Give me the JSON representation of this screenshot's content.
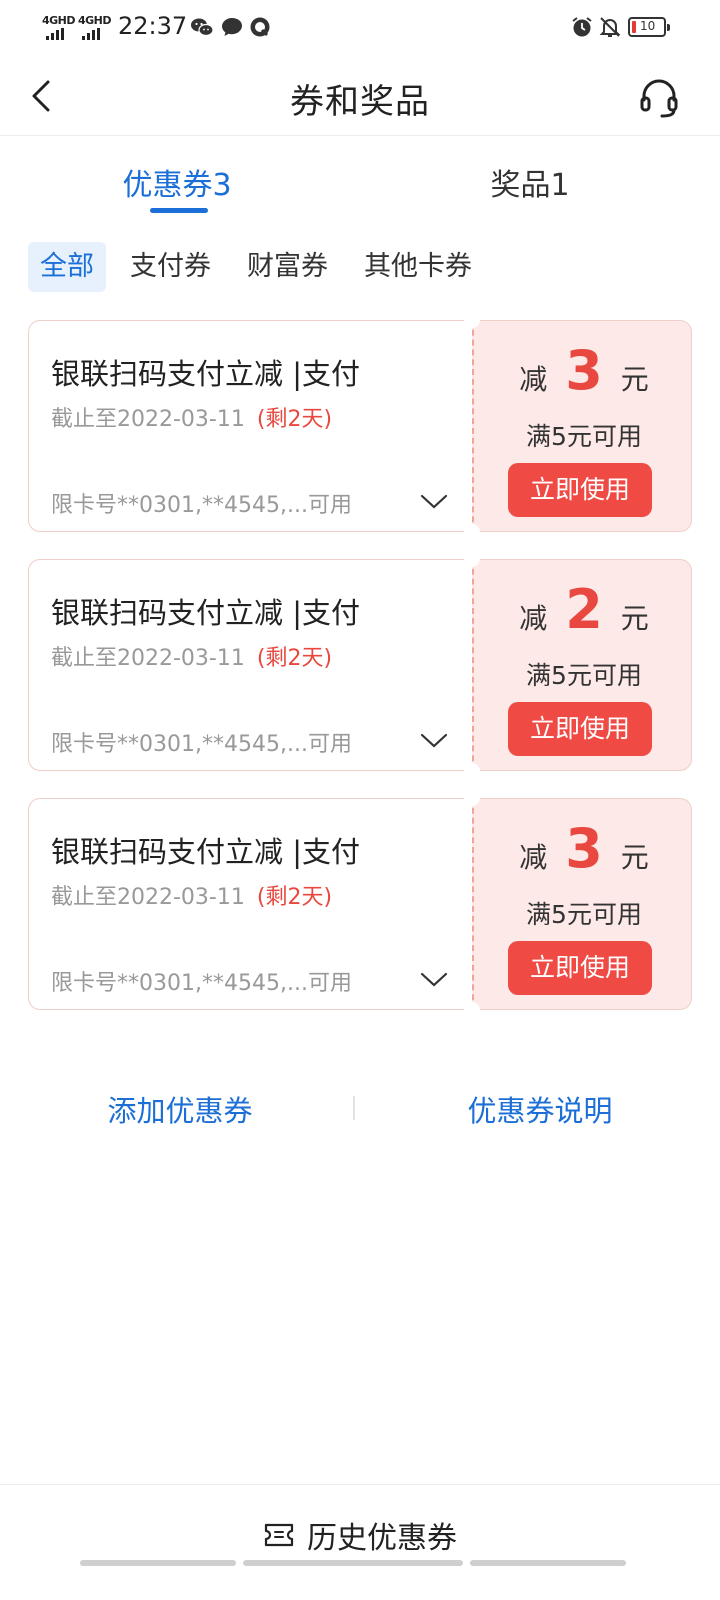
{
  "status_bar": {
    "signal1": "4GHD",
    "signal2": "4GHD",
    "time": "22:37",
    "battery": "10",
    "icons": [
      "wechat-icon",
      "message-icon",
      "q-app-icon",
      "alarm-icon",
      "bell-off-icon",
      "battery-icon"
    ]
  },
  "nav": {
    "title": "券和奖品",
    "back_icon": "chevron-left-icon",
    "support_icon": "headset-icon"
  },
  "tabs": [
    {
      "label": "优惠券3",
      "active": true
    },
    {
      "label": "奖品1",
      "active": false
    }
  ],
  "filters": [
    {
      "label": "全部",
      "active": true
    },
    {
      "label": "支付券",
      "active": false
    },
    {
      "label": "财富券",
      "active": false
    },
    {
      "label": "其他卡券",
      "active": false
    }
  ],
  "coupons": [
    {
      "title": "银联扫码支付立减 |支付",
      "expiry": "截止至2022-03-11",
      "remaining": "(剩2天)",
      "cards": "限卡号**0301,**4545,...可用",
      "prefix": "减",
      "amount": "3",
      "unit": "元",
      "condition": "满5元可用",
      "button": "立即使用"
    },
    {
      "title": "银联扫码支付立减 |支付",
      "expiry": "截止至2022-03-11",
      "remaining": "(剩2天)",
      "cards": "限卡号**0301,**4545,...可用",
      "prefix": "减",
      "amount": "2",
      "unit": "元",
      "condition": "满5元可用",
      "button": "立即使用"
    },
    {
      "title": "银联扫码支付立减 |支付",
      "expiry": "截止至2022-03-11",
      "remaining": "(剩2天)",
      "cards": "限卡号**0301,**4545,...可用",
      "prefix": "减",
      "amount": "3",
      "unit": "元",
      "condition": "满5元可用",
      "button": "立即使用"
    }
  ],
  "links": {
    "add": "添加优惠券",
    "explain": "优惠券说明"
  },
  "bottom": {
    "history": "历史优惠券",
    "icon": "ticket-icon"
  },
  "colors": {
    "accent_blue": "#1b6fd6",
    "coupon_red": "#e8483f",
    "button_red": "#f04a45",
    "coupon_bg": "#fde9e7"
  }
}
